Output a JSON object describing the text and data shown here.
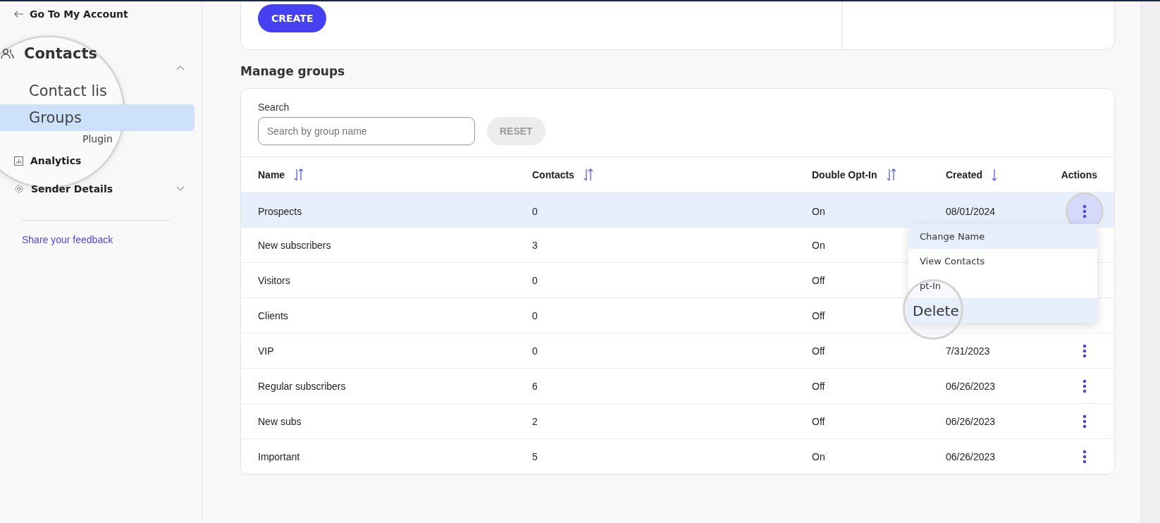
{
  "sidebar": {
    "back_link": "Go To My Account",
    "nav": [
      {
        "label": "Contacts",
        "kind": "section",
        "magnified": true,
        "expanded": true,
        "children": [
          {
            "label": "Contact lis",
            "magnified": true,
            "selected": false
          },
          {
            "label": "Groups",
            "magnified": true,
            "selected": true
          },
          {
            "label": "Plugin",
            "magnified": false,
            "selected": false
          }
        ]
      },
      {
        "label": "Analytics",
        "kind": "analytics"
      },
      {
        "label": "Sender Details",
        "kind": "settings",
        "expanded": false
      }
    ],
    "feedback_link": "Share your feedback"
  },
  "create_card": {
    "button": "CREATE"
  },
  "manage_groups": {
    "title": "Manage groups",
    "search": {
      "label": "Search",
      "placeholder": "Search by group name"
    },
    "reset_button": "RESET",
    "table": {
      "columns": [
        {
          "label": "Name",
          "kind": "sortable"
        },
        {
          "label": "Contacts",
          "kind": "sortable"
        },
        {
          "label": "Double Opt-In",
          "kind": "sortable"
        },
        {
          "label": "Created",
          "kind": "descending"
        },
        {
          "label": "Actions",
          "kind": "plain"
        }
      ],
      "rows": [
        {
          "name": "Prospects",
          "contacts": "0",
          "double_opt_in": "On",
          "created": "08/01/2024",
          "selected": true
        },
        {
          "name": "New subscribers",
          "contacts": "3",
          "double_opt_in": "On",
          "created": "",
          "selected": false
        },
        {
          "name": "Visitors",
          "contacts": "0",
          "double_opt_in": "Off",
          "created": "",
          "selected": false
        },
        {
          "name": "Clients",
          "contacts": "0",
          "double_opt_in": "Off",
          "created": "",
          "selected": false
        },
        {
          "name": "VIP",
          "contacts": "0",
          "double_opt_in": "Off",
          "created": "7/31/2023",
          "selected": false
        },
        {
          "name": "Regular subscribers",
          "contacts": "6",
          "double_opt_in": "Off",
          "created": "06/26/2023",
          "selected": false
        },
        {
          "name": "New subs",
          "contacts": "2",
          "double_opt_in": "Off",
          "created": "06/26/2023",
          "selected": false
        },
        {
          "name": "Important",
          "contacts": "5",
          "double_opt_in": "On",
          "created": "06/26/2023",
          "selected": false
        }
      ]
    },
    "action_menu": [
      {
        "label": "Change Name",
        "highlighted": true,
        "magnified": false
      },
      {
        "label": "View Contacts",
        "highlighted": false,
        "magnified": false
      },
      {
        "label": "pt-In",
        "highlighted": false,
        "magnified": false
      },
      {
        "label": "Delete",
        "highlighted": true,
        "magnified": true
      }
    ]
  }
}
